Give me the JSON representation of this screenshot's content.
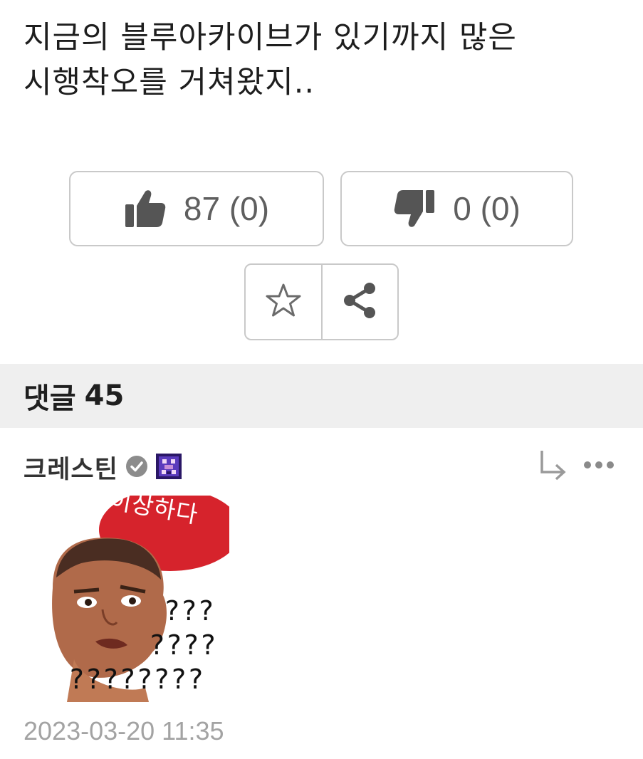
{
  "post": {
    "body_lines": [
      "지금의 블루아카이브가 있기까지 많은",
      "시행착오를 거쳐왔지.."
    ]
  },
  "votes": {
    "up_icon": "thumbs-up-icon",
    "up_count": "87 (0)",
    "down_icon": "thumbs-down-icon",
    "down_count": "0 (0)"
  },
  "actions": {
    "bookmark_icon": "star-outline-icon",
    "share_icon": "share-icon"
  },
  "comments": {
    "label": "댓글",
    "count": "45",
    "items": [
      {
        "author": "크레스틴",
        "verified_icon": "check-circle-icon",
        "level_badge_icon": "pixel-badge-icon",
        "reply_icon": "reply-arrow-icon",
        "more_icon": "more-dots-icon",
        "sticker": {
          "bubble_text": "이상하다",
          "question_lines": [
            "???",
            "????",
            "????????"
          ]
        },
        "timestamp": "2023-03-20 11:35"
      }
    ]
  },
  "colors": {
    "border": "#c9c9c9",
    "header_bg": "#efefef",
    "icon": "#555555",
    "timestamp": "#a3a3a3",
    "sticker_red": "#d6232c",
    "badge_purple": "#3b1f8a"
  }
}
